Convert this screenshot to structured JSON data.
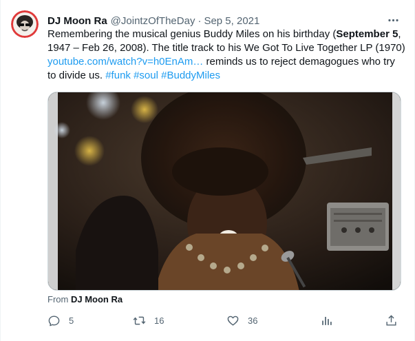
{
  "tweet": {
    "author_name": "DJ Moon Ra",
    "handle": "@JointzOfTheDay",
    "separator": "·",
    "date": "Sep 5, 2021",
    "text_part1": "Remembering the musical genius Buddy Miles on his birthday (",
    "text_bold1": "September 5",
    "text_part2": ", 1947 – Feb 26, 2008). The title track to his We Got To Live Together LP (1970) ",
    "link_url": "youtube.com/watch?v=h0EnAm…",
    "text_part3": " reminds us to reject demagogues who try to divide us. ",
    "hashtag1": "#funk",
    "hashtag2": "#soul",
    "hashtag3": "#BuddyMiles",
    "from_label": "From",
    "from_name": "DJ Moon Ra"
  },
  "actions": {
    "replies": "5",
    "retweets": "16",
    "likes": "36"
  },
  "icons": {
    "more": "more-icon",
    "reply": "reply-icon",
    "retweet": "retweet-icon",
    "like": "heart-icon",
    "views": "views-icon",
    "share": "share-icon"
  },
  "colors": {
    "link": "#1d9bf0",
    "muted": "#536471",
    "text": "#0f1419"
  }
}
